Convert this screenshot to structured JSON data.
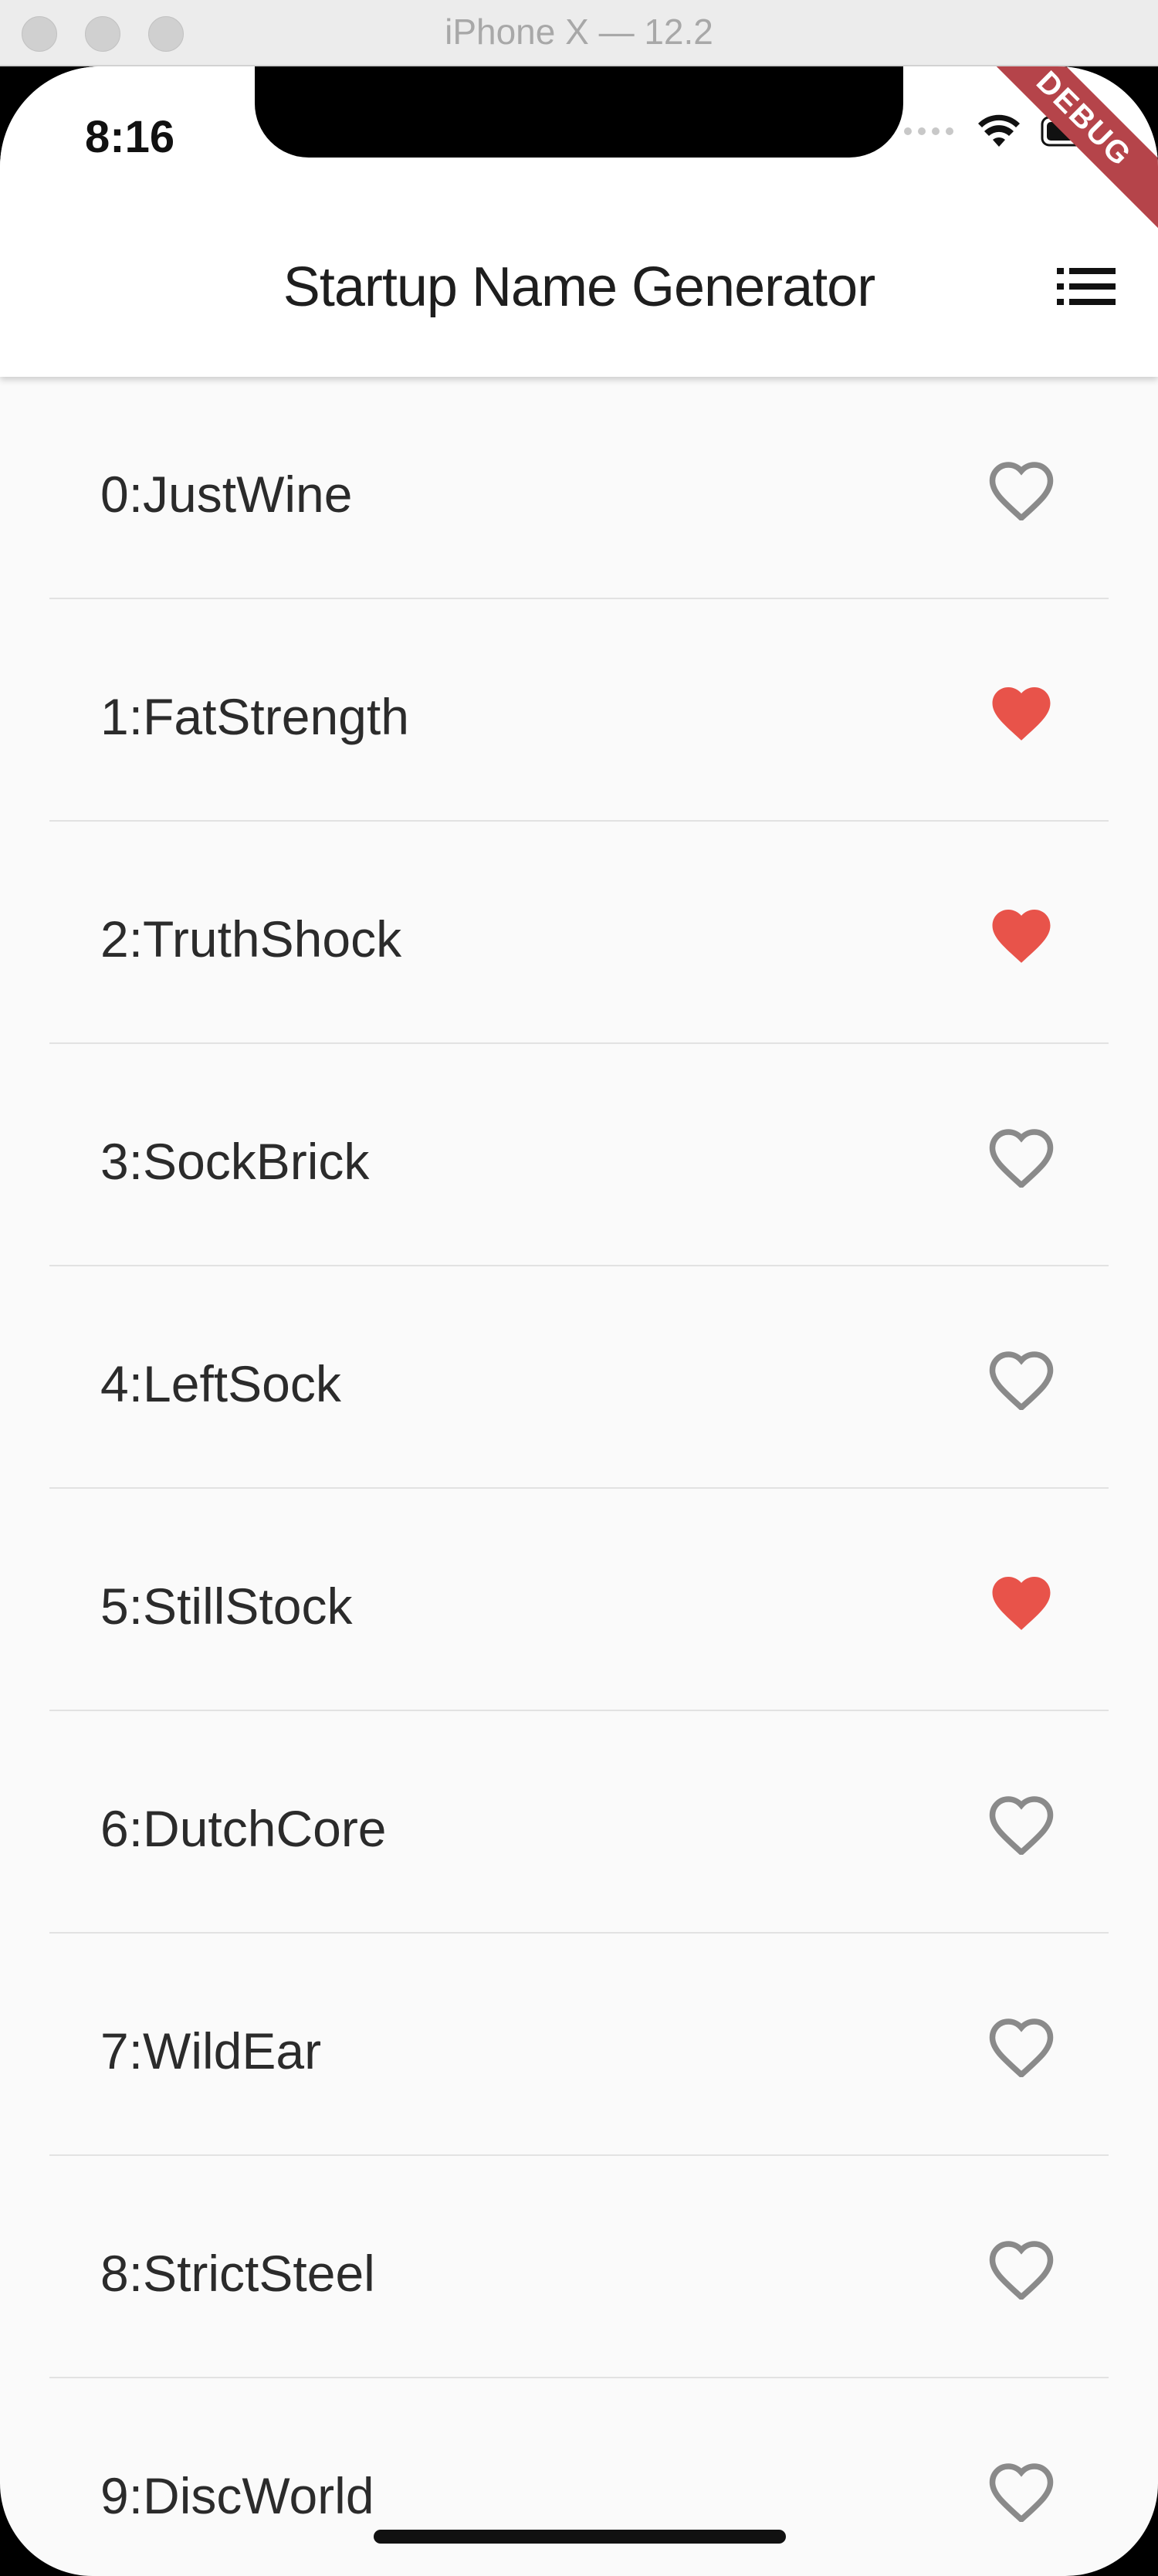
{
  "window": {
    "title": "iPhone X — 12.2"
  },
  "status_bar": {
    "time": "8:16"
  },
  "app_bar": {
    "title": "Startup Name Generator",
    "list_icon": "list-icon",
    "debug_banner": "DEBUG"
  },
  "colors": {
    "favorite": "#e8534a",
    "not_favorite": "#8a8a8a",
    "debug_banner": "#b5444a"
  },
  "items": [
    {
      "label": "0:JustWine",
      "favorite": false
    },
    {
      "label": "1:FatStrength",
      "favorite": true
    },
    {
      "label": "2:TruthShock",
      "favorite": true
    },
    {
      "label": "3:SockBrick",
      "favorite": false
    },
    {
      "label": "4:LeftSock",
      "favorite": false
    },
    {
      "label": "5:StillStock",
      "favorite": true
    },
    {
      "label": "6:DutchCore",
      "favorite": false
    },
    {
      "label": "7:WildEar",
      "favorite": false
    },
    {
      "label": "8:StrictSteel",
      "favorite": false
    },
    {
      "label": "9:DiscWorld",
      "favorite": false
    }
  ]
}
